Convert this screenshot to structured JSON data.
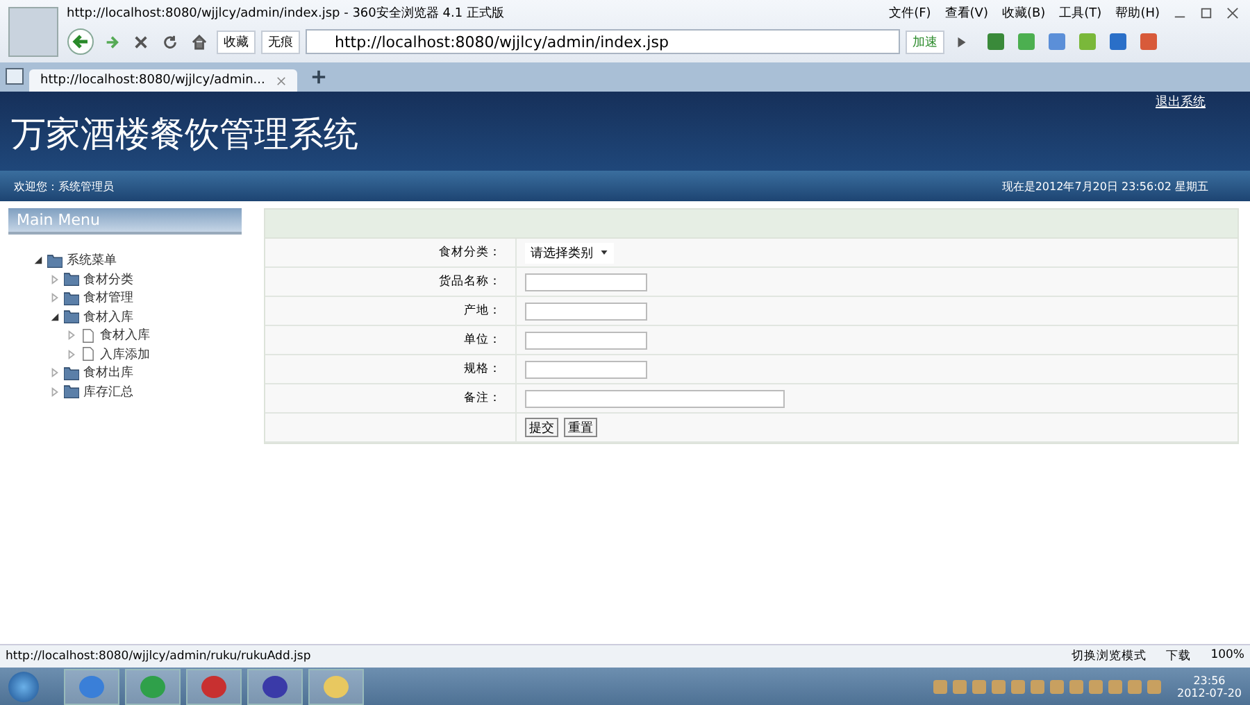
{
  "browser": {
    "title": "http://localhost:8080/wjjlcy/admin/index.jsp - 360安全浏览器 4.1 正式版",
    "menu": [
      "文件(F)",
      "查看(V)",
      "收藏(B)",
      "工具(T)",
      "帮助(H)"
    ],
    "toolbar": {
      "favorites": "收藏",
      "no_trace": "无痕",
      "speed": "加速"
    },
    "address": "http://localhost:8080/wjjlcy/admin/index.jsp",
    "tabs": [
      {
        "label": "http://localhost:8080/wjjlcy/admin...",
        "selected": true
      }
    ],
    "status_url": "http://localhost:8080/wjjlcy/admin/ruku/rukuAdd.jsp",
    "status_items": {
      "mode": "切换浏览模式",
      "download": "下载",
      "zoom": "100%"
    }
  },
  "page": {
    "logout": "退出系统",
    "title": "万家酒楼餐饮管理系统",
    "welcome": "欢迎您：系统管理员",
    "datetime": "现在是2012年7月20日 23:56:02 星期五",
    "menu_title": "Main Menu",
    "tree": [
      {
        "label": "系统菜单",
        "expanded": true,
        "kind": "folder",
        "children": [
          {
            "label": "食材分类",
            "expanded": false,
            "kind": "folder"
          },
          {
            "label": "食材管理",
            "expanded": false,
            "kind": "folder"
          },
          {
            "label": "食材入库",
            "expanded": true,
            "kind": "folder",
            "children": [
              {
                "label": "食材入库",
                "expanded": false,
                "kind": "page"
              },
              {
                "label": "入库添加",
                "expanded": false,
                "kind": "page"
              }
            ]
          },
          {
            "label": "食材出库",
            "expanded": false,
            "kind": "folder"
          },
          {
            "label": "库存汇总",
            "expanded": false,
            "kind": "folder"
          }
        ]
      }
    ],
    "form": [
      {
        "label": "食材分类：",
        "kind": "select",
        "value": "请选择类别"
      },
      {
        "label": "货品名称：",
        "kind": "text"
      },
      {
        "label": "产地：",
        "kind": "text"
      },
      {
        "label": "单位：",
        "kind": "text"
      },
      {
        "label": "规格：",
        "kind": "text"
      },
      {
        "label": "备注：",
        "kind": "wide"
      }
    ],
    "buttons": [
      "提交",
      "重置"
    ]
  },
  "taskbar": {
    "time": "23:56",
    "date": "2012-07-20"
  }
}
